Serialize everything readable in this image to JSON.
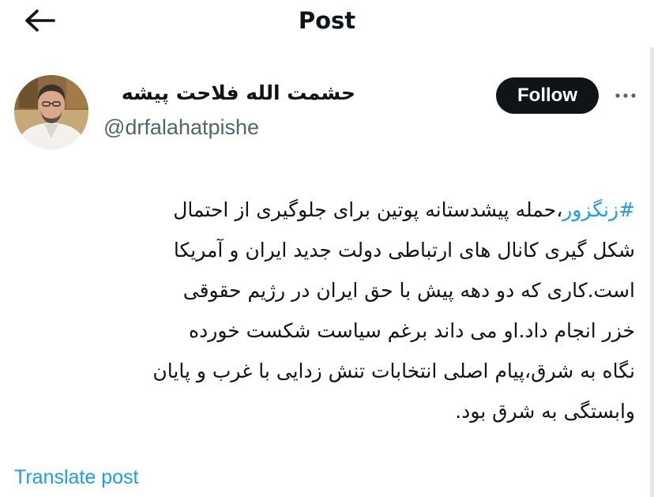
{
  "header": {
    "title": "Post",
    "back_icon": "arrow-left-icon"
  },
  "author": {
    "name": "حشمت الله فلاحت پیشه",
    "handle": "@drfalahatpishe",
    "avatar": "profile-photo"
  },
  "actions": {
    "follow_label": "Follow",
    "more_icon": "more-horizontal-icon"
  },
  "post": {
    "hashtag": "#زنگزور",
    "lines": [
      "،حمله پیشدستانه پوتین برای جلوگیری از احتمال",
      "شکل گیری کانال های ارتباطی دولت جدید ایران و آمریکا",
      "است.کاری که دو دهه پیش با حق ایران در رژیم حقوقی",
      "خزر انجام داد.او می داند برغم سیاست شکست خورده",
      "نگاه به شرق،پیام اصلی انتخابات تنش زدایی با غرب و پایان",
      "وابستگی به شرق بود."
    ]
  },
  "translate": {
    "label": "Translate post"
  },
  "colors": {
    "text": "#0f1419",
    "secondary": "#536471",
    "accent": "#1d9bf0",
    "button_bg": "#0f1419",
    "button_text": "#ffffff"
  }
}
